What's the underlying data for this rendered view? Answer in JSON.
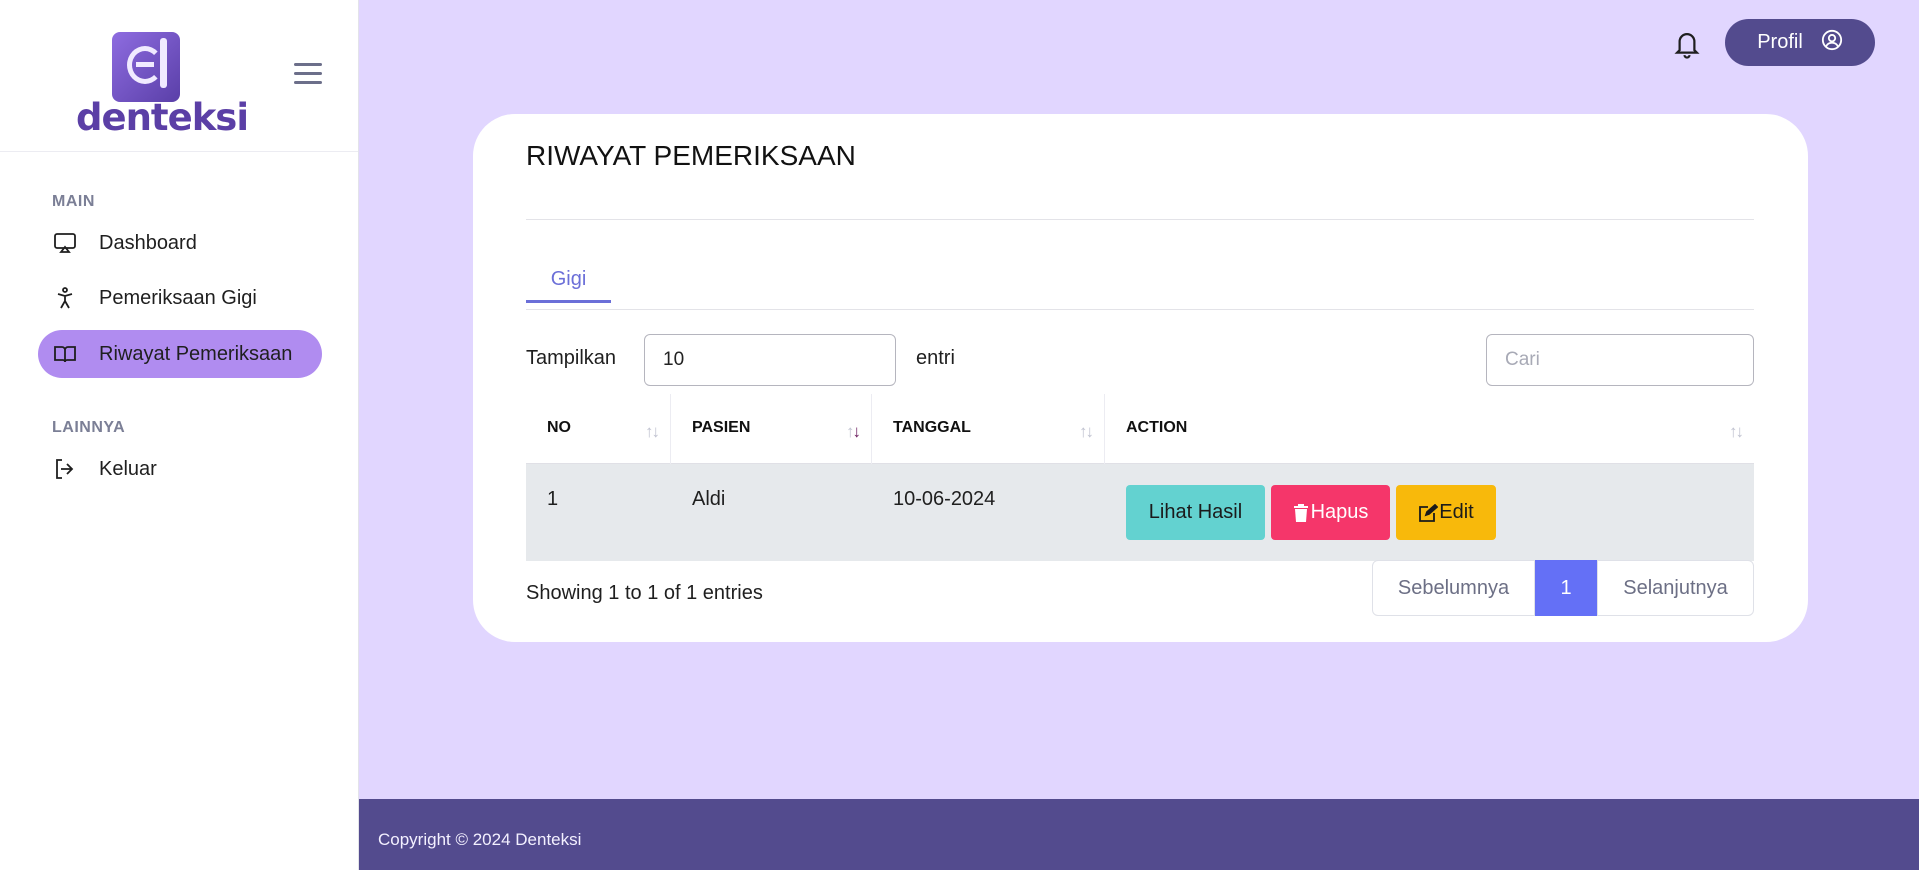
{
  "brand": {
    "name": "denteksi"
  },
  "sidebar": {
    "sections": [
      {
        "title": "MAIN",
        "items": [
          {
            "label": "Dashboard",
            "icon": "monitor-icon"
          },
          {
            "label": "Pemeriksaan Gigi",
            "icon": "person-icon"
          },
          {
            "label": "Riwayat Pemeriksaan",
            "icon": "book-icon",
            "active": true
          }
        ]
      },
      {
        "title": "LAINNYA",
        "items": [
          {
            "label": "Keluar",
            "icon": "logout-icon"
          }
        ]
      }
    ]
  },
  "header": {
    "profile_label": "Profil",
    "icons": [
      "bell-icon",
      "user-circle-icon"
    ]
  },
  "card": {
    "title": "RIWAYAT PEMERIKSAAN",
    "tabs": [
      {
        "label": "Gigi",
        "active": true
      }
    ],
    "controls": {
      "show_label": "Tampilkan",
      "page_size": "10",
      "entries_label": "entri",
      "search_placeholder": "Cari"
    },
    "table": {
      "columns": [
        "NO",
        "PASIEN",
        "TANGGAL",
        "ACTION"
      ],
      "rows": [
        {
          "no": "1",
          "pasien": "Aldi",
          "tanggal": "10-06-2024"
        }
      ],
      "action_labels": {
        "view": "Lihat Hasil",
        "delete": "Hapus",
        "edit": "Edit"
      }
    },
    "info": "Showing 1 to 1 of 1 entries",
    "pagination": {
      "prev": "Sebelumnya",
      "current": "1",
      "next": "Selanjutnya"
    }
  },
  "footer": {
    "text": "Copyright © 2024 Denteksi"
  },
  "colors": {
    "background": "#e1d6ff",
    "accent": "#534b8e",
    "active_nav": "#b08cf0",
    "tab": "#6b6fd8",
    "view": "#63d2d0",
    "delete": "#f5366a",
    "edit": "#f8b90b",
    "page_active": "#6470f6"
  }
}
